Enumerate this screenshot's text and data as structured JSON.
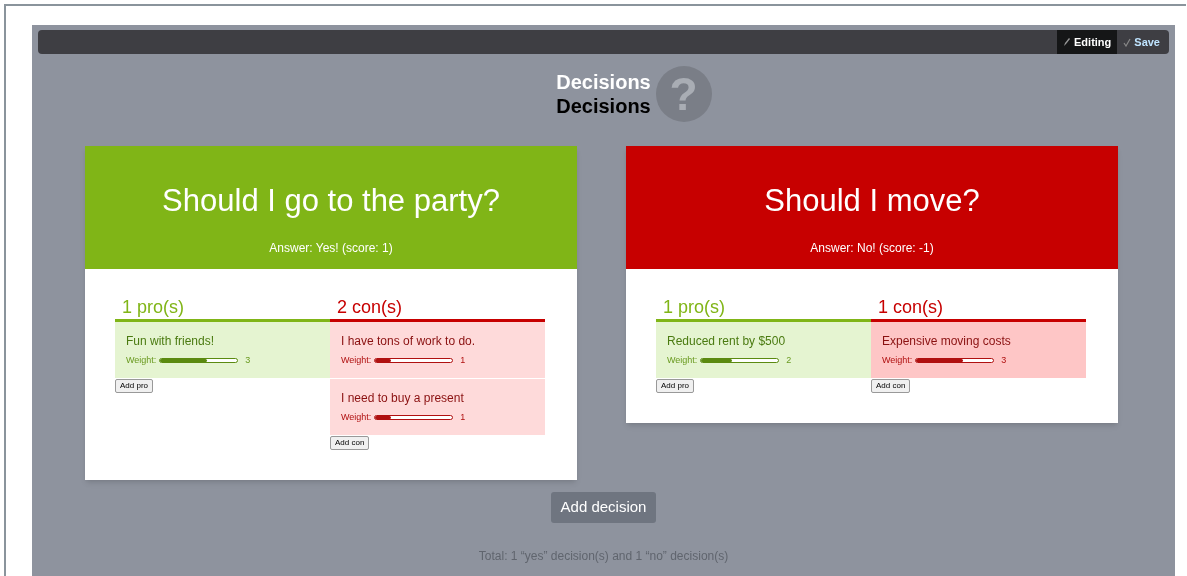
{
  "toolbar": {
    "buttons": [
      {
        "label": "Editing",
        "selected": true
      },
      {
        "label": "Save",
        "selected": false
      }
    ]
  },
  "logo": {
    "line_1": "Decisions",
    "line_2": "Decisions",
    "mark": "?"
  },
  "decisions": [
    {
      "question": "Should I go to the party?",
      "answer": "Answer: Yes! (score: 1)",
      "kind": "yes",
      "pros": {
        "heading": "1 pro(s)",
        "items": [
          {
            "text": "Fun with friends!",
            "weight_label": "Weight:",
            "level": 0.6,
            "reading": "3"
          }
        ],
        "add_button": "Add pro"
      },
      "cons": {
        "heading": "2 con(s)",
        "items": [
          {
            "text": "I have tons of work to do.",
            "weight_label": "Weight:",
            "level": 0.2,
            "reading": "1"
          },
          {
            "text": "I need to buy a present",
            "weight_label": "Weight:",
            "level": 0.2,
            "reading": "1"
          }
        ],
        "add_button": "Add con"
      }
    },
    {
      "question": "Should I move?",
      "answer": "Answer: No! (score: -1)",
      "kind": "no",
      "pros": {
        "heading": "1 pro(s)",
        "items": [
          {
            "text": "Reduced rent by $500",
            "weight_label": "Weight:",
            "level": 0.4,
            "reading": "2"
          }
        ],
        "add_button": "Add pro"
      },
      "cons": {
        "heading": "1 con(s)",
        "items": [
          {
            "text": "Expensive moving costs",
            "weight_label": "Weight:",
            "level": 0.6,
            "reading": "3"
          }
        ],
        "add_button": "Add con"
      }
    }
  ],
  "add_decision": "Add decision",
  "total": "Total: 1 “yes” decision(s) and 1 “no” decision(s)"
}
